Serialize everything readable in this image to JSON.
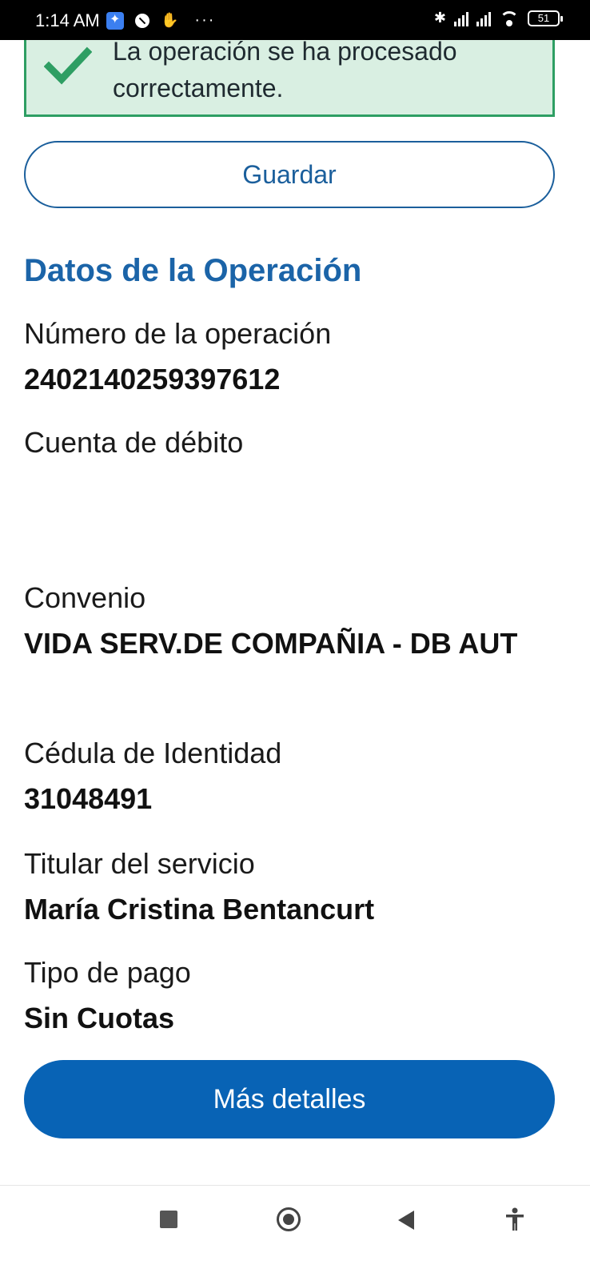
{
  "status_bar": {
    "time": "1:14 AM",
    "battery": "51",
    "icons": [
      "assistant-icon",
      "notification-icon",
      "glove-icon",
      "more-icon",
      "bluetooth-icon",
      "signal-icon",
      "signal-roaming-icon",
      "wifi-icon",
      "battery-icon"
    ]
  },
  "banner": {
    "message": "La operación se ha procesado correctamente.",
    "icon": "check-icon",
    "border_color": "#2e9e63",
    "background": "#d9efe2"
  },
  "actions": {
    "save_label": "Guardar",
    "details_label": "Más detalles"
  },
  "section": {
    "title": "Datos de la Operación"
  },
  "fields": {
    "operation_number_label": "Número de la operación",
    "operation_number_value": "2402140259397612",
    "debit_account_label": "Cuenta de débito",
    "convenio_label": "Convenio",
    "convenio_value": "VIDA SERV.DE COMPAÑIA - DB AUT",
    "id_label": "Cédula de Identidad",
    "id_value": "31048491",
    "holder_label": "Titular del servicio",
    "holder_value": "María Cristina Bentancurt",
    "payment_type_label": "Tipo de pago",
    "payment_type_value": "Sin Cuotas"
  },
  "colors": {
    "accent": "#1b64a8",
    "primary_button": "#0863b5"
  },
  "nav_bar": {
    "icons": [
      "recents-square-icon",
      "home-circle-icon",
      "back-triangle-icon",
      "accessibility-icon"
    ]
  }
}
